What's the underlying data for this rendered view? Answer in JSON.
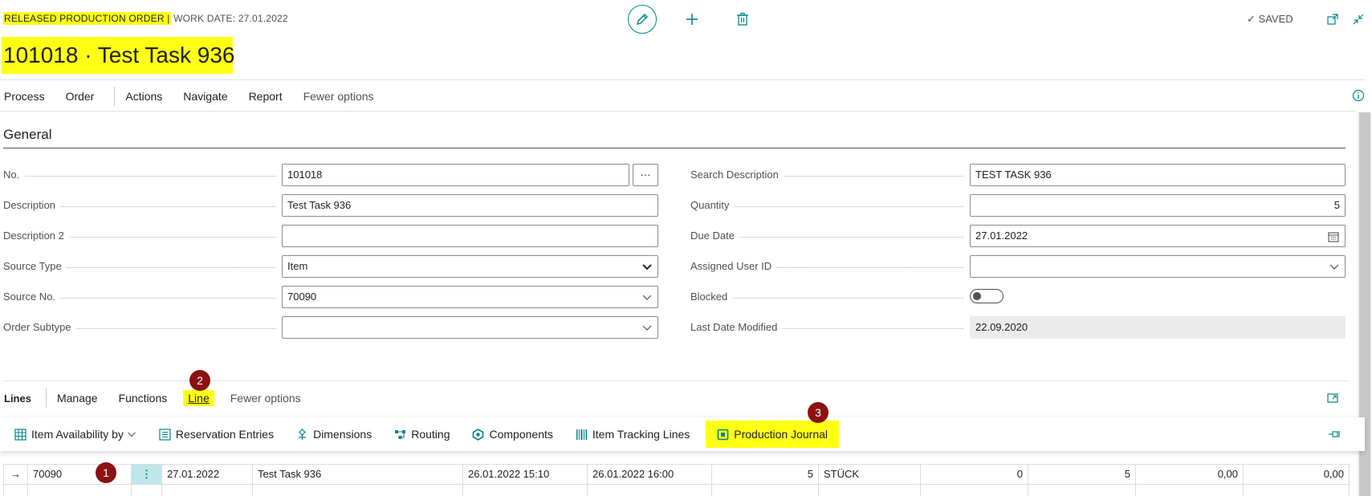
{
  "header": {
    "kind": "RELEASED PRODUCTION ORDER |",
    "work_date": "WORK DATE: 27.01.2022",
    "title": "101018 · Test Task 936",
    "saved": "SAVED"
  },
  "menu": {
    "items": [
      "Process",
      "Order",
      "Actions",
      "Navigate",
      "Report"
    ],
    "fewer": "Fewer options"
  },
  "general": {
    "title": "General",
    "left": [
      {
        "label": "No.",
        "value": "101018"
      },
      {
        "label": "Description",
        "value": "Test Task 936"
      },
      {
        "label": "Description 2",
        "value": ""
      },
      {
        "label": "Source Type",
        "value": "Item"
      },
      {
        "label": "Source No.",
        "value": "70090"
      },
      {
        "label": "Order Subtype",
        "value": ""
      }
    ],
    "right": [
      {
        "label": "Search Description",
        "value": "TEST TASK 936"
      },
      {
        "label": "Quantity",
        "value": "5"
      },
      {
        "label": "Due Date",
        "value": "27.01.2022"
      },
      {
        "label": "Assigned User ID",
        "value": ""
      },
      {
        "label": "Blocked",
        "value": ""
      },
      {
        "label": "Last Date Modified",
        "value": "22.09.2020"
      }
    ]
  },
  "lines": {
    "title": "Lines",
    "tabs": [
      "Manage",
      "Functions",
      "Line"
    ],
    "fewer": "Fewer options",
    "badges": [
      "1",
      "2",
      "3"
    ],
    "actions": [
      {
        "label": "Item Availability by",
        "icon": "grid-icon"
      },
      {
        "label": "Reservation Entries",
        "icon": "ledger-icon"
      },
      {
        "label": "Dimensions",
        "icon": "dimensions-icon"
      },
      {
        "label": "Routing",
        "icon": "routing-icon"
      },
      {
        "label": "Components",
        "icon": "components-icon"
      },
      {
        "label": "Item Tracking Lines",
        "icon": "barcode-icon"
      },
      {
        "label": "Production Journal",
        "icon": "journal-icon"
      }
    ],
    "row": {
      "item_no": "70090",
      "due_date": "27.01.2022",
      "description": "Test Task 936",
      "starting": "26.01.2022 15:10",
      "ending": "26.01.2022 16:00",
      "quantity": "5",
      "uom": "STÜCK",
      "finished_qty": "0",
      "remaining_qty": "5",
      "unit_cost": "0,00",
      "cost_amount": "0,00"
    }
  },
  "colors": {
    "accent": "#00858a",
    "highlight": "#ffff14",
    "badge": "#8b1212"
  }
}
